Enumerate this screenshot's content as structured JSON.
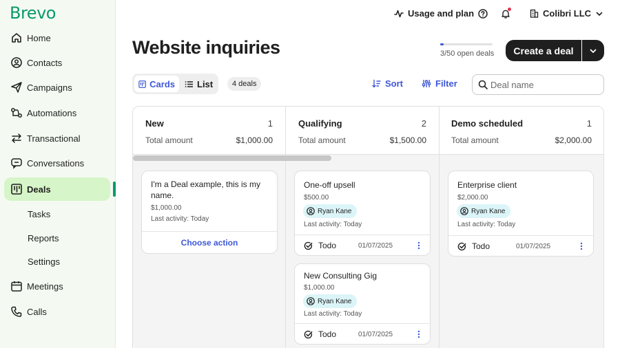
{
  "brand": {
    "logo": "Brevo",
    "accent": "#0b996e",
    "link_color": "#3e57d6"
  },
  "sidebar": {
    "items": [
      {
        "label": "Home",
        "icon": "home-icon"
      },
      {
        "label": "Contacts",
        "icon": "contact-icon"
      },
      {
        "label": "Campaigns",
        "icon": "send-icon"
      },
      {
        "label": "Automations",
        "icon": "automation-icon"
      },
      {
        "label": "Transactional",
        "icon": "swap-icon"
      },
      {
        "label": "Conversations",
        "icon": "chat-icon"
      },
      {
        "label": "Deals",
        "icon": "deals-icon",
        "active": true
      },
      {
        "label": "Meetings",
        "icon": "calendar-icon"
      },
      {
        "label": "Calls",
        "icon": "phone-icon"
      }
    ],
    "deals_sub": [
      "Tasks",
      "Reports",
      "Settings"
    ]
  },
  "topbar": {
    "usage_label": "Usage and plan",
    "company": "Colibri LLC"
  },
  "page": {
    "title": "Website inquiries",
    "open_deals_label": "3/50 open deals",
    "open_deals_progress": 0.06,
    "create_label": "Create a deal"
  },
  "toolbar": {
    "cards_label": "Cards",
    "list_label": "List",
    "count_label": "4 deals",
    "sort_label": "Sort",
    "filter_label": "Filter",
    "search_placeholder": "Deal name"
  },
  "board": {
    "total_label": "Total amount",
    "columns": [
      {
        "name": "New",
        "count": "1",
        "total": "$1,000.00",
        "cards": [
          {
            "title": "I'm a Deal example, this is my name.",
            "amount": "$1,000.00",
            "last_activity": "Last activity: Today",
            "action": "Choose action"
          }
        ]
      },
      {
        "name": "Qualifying",
        "count": "2",
        "total": "$1,500.00",
        "cards": [
          {
            "title": "One-off upsell",
            "amount": "$500.00",
            "owner": "Ryan Kane",
            "last_activity": "Last activity: Today",
            "task": "Todo",
            "date": "01/07/2025"
          },
          {
            "title": "New Consulting Gig",
            "amount": "$1,000.00",
            "owner": "Ryan Kane",
            "last_activity": "Last activity: Today",
            "task": "Todo",
            "date": "01/07/2025"
          }
        ]
      },
      {
        "name": "Demo scheduled",
        "count": "1",
        "total": "$2,000.00",
        "cards": [
          {
            "title": "Enterprise client",
            "amount": "$2,000.00",
            "owner": "Ryan Kane",
            "last_activity": "Last activity: Today",
            "task": "Todo",
            "date": "01/07/2025"
          }
        ]
      }
    ]
  }
}
